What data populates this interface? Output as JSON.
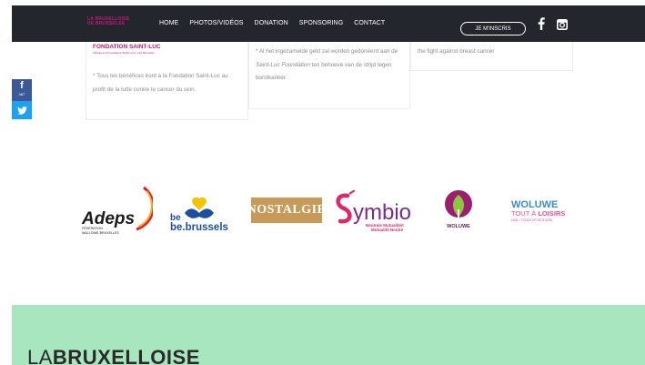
{
  "nav": {
    "logo_line1": "LA BRUXELLOISE",
    "logo_line2": "DE BRUSSELSE",
    "menu": [
      "HOME",
      "PHOTOS/VIDÉOS",
      "DONATION",
      "SPONSORING",
      "CONTACT"
    ],
    "signup_label": "JE M'INSCRIS",
    "icons": [
      "facebook-icon",
      "instagram-icon"
    ]
  },
  "cards": {
    "fondation_title": "FONDATION SAINT-LUC",
    "fondation_sub": "Cliniques Universitaires SAINT-LUC UCL Bruxelles",
    "fr_text": "* Tous les bénéfices iront à la Fondation Saint-Luc au profit de la lutte contre le cancer du sein.",
    "nl_text_1": "* Al het ingezamelde geld zal worden gedoneerd aan de ",
    "nl_text_em": "Saint-Luc Foundation",
    "nl_text_2": " ten behoeve van de strijd tegen borstkanker.",
    "en_text": "the fight against breast cancer"
  },
  "share": {
    "fb_count": "487"
  },
  "sponsors": {
    "adeps_name": "Adeps",
    "adeps_sub1": "FÉDÉRATION",
    "adeps_sub2": "WALLONIE-BRUXELLES",
    "bebxl_be": "be",
    "bebxl_name": "be.brussels",
    "nostalgie": "NOSTALGIE",
    "symbio": "Symbio",
    "symbio_sub1": "Neutrale Mutualiteit",
    "symbio_sub2": "Mutualité Neutre",
    "woluwe_sub": "WOLUWE",
    "woluwe2_l1": "WOLUWE",
    "woluwe2_l2a": "TOUT À ",
    "woluwe2_l2b": "LOISIRS",
    "woluwe2_l3": "ASBL • FONDS SPORTIF ASBL"
  },
  "footer": {
    "brand_light": "LA",
    "brand_bold": "BRUXELLOISE"
  },
  "colors": {
    "nav_bg": "#24262d",
    "accent": "#c21b74",
    "green_band": "#a8e6c0",
    "facebook": "#3b5998",
    "twitter": "#1da1f2"
  }
}
